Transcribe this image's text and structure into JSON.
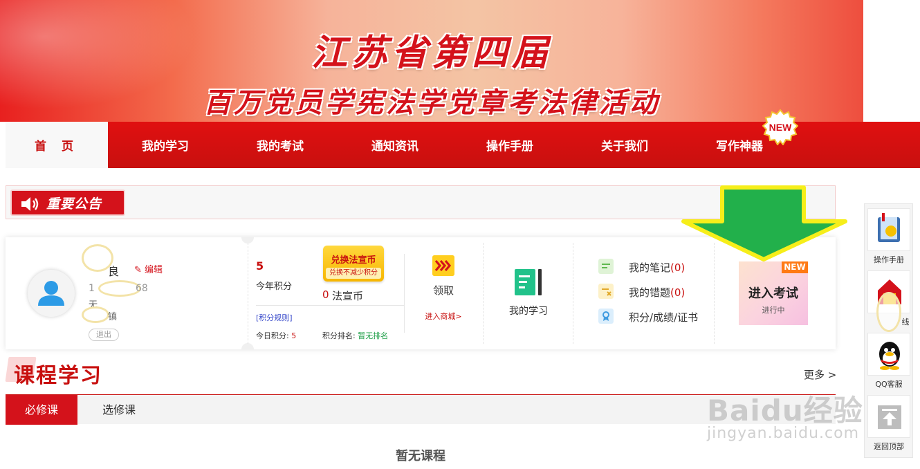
{
  "banner": {
    "title_line1": "江苏省第四届",
    "title_line2": "百万党员学宪法学党章考法律活动"
  },
  "nav": {
    "items": [
      {
        "label": "首 页"
      },
      {
        "label": "我的学习"
      },
      {
        "label": "我的考试"
      },
      {
        "label": "通知资讯"
      },
      {
        "label": "操作手册"
      },
      {
        "label": "关于我们"
      },
      {
        "label": "写作神器"
      }
    ],
    "new_badge": "NEW"
  },
  "notice": {
    "tag": "重要公告"
  },
  "user": {
    "name_visible": "良",
    "edit_label": "编辑",
    "phone_prefix": "1",
    "phone_suffix": "68",
    "org": "无",
    "town": "镇",
    "logout_label": "退出"
  },
  "points": {
    "year_points": "5",
    "year_points_label": "今年积分",
    "exchange_title": "兑换法宣币",
    "exchange_sub": "兑换不减少积分",
    "coin_count": "0",
    "coin_label": "法宣币",
    "rules_link": "[积分规则]",
    "today_label": "今日积分:",
    "today_value": "5",
    "rank_label": "积分排名:",
    "rank_value": "暂无排名"
  },
  "claim": {
    "label": "领取",
    "mall_link": "进入商城>"
  },
  "study": {
    "label": "我的学习"
  },
  "links": [
    {
      "label": "我的笔记",
      "count": "(0)"
    },
    {
      "label": "我的错题",
      "count": "(0)"
    },
    {
      "label": "积分/成绩/证书",
      "count": ""
    }
  ],
  "exam": {
    "badge": "NEW",
    "title": "进入考试",
    "status": "进行中"
  },
  "course": {
    "title": "课程学习",
    "more": "更多 >",
    "tabs": [
      {
        "label": "必修课"
      },
      {
        "label": "选修课"
      }
    ],
    "empty": "暂无课程"
  },
  "sidebar": {
    "items": [
      {
        "label": "操作手册"
      },
      {
        "label": "线"
      },
      {
        "label": "QQ客服"
      },
      {
        "label": "返回顶部"
      }
    ]
  },
  "watermark": {
    "brand": "Baidu经验",
    "url": "jingyan.baidu.com"
  },
  "colors": {
    "primary_red": "#d4121b",
    "arrow_green": "#22b04b",
    "arrow_outline": "#f6ee1a"
  }
}
